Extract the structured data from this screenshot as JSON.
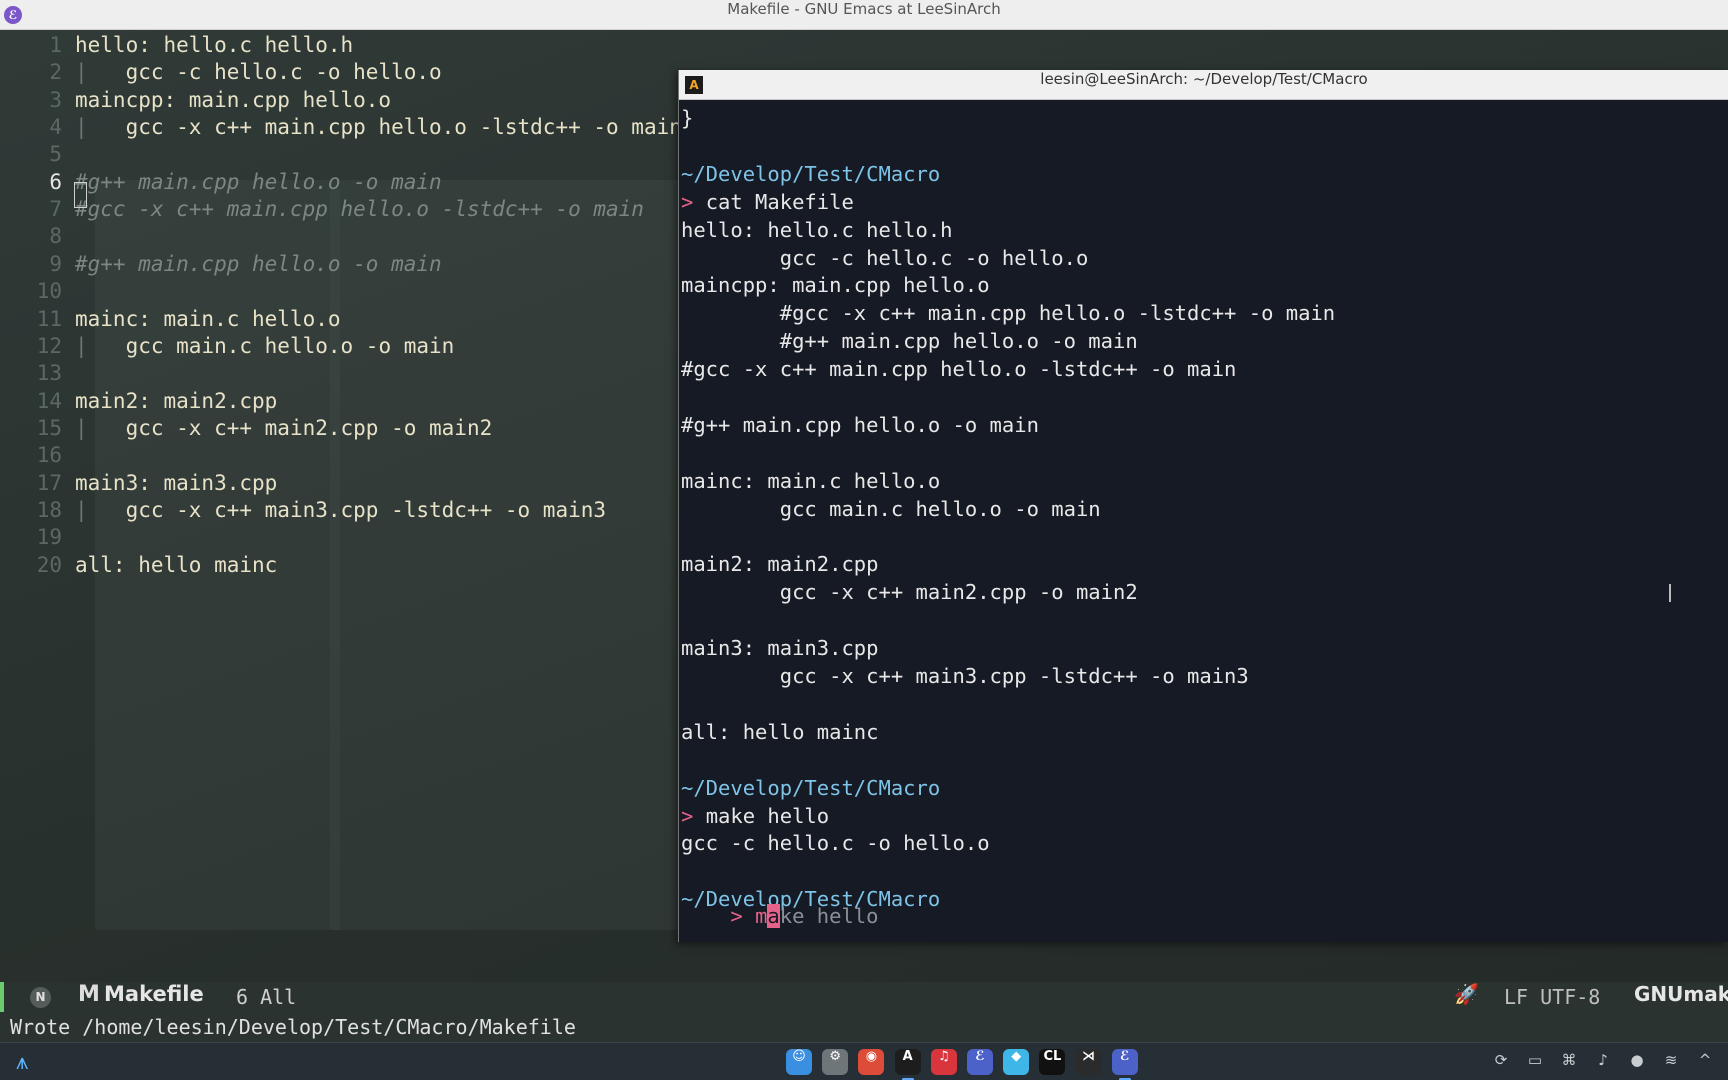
{
  "emacs": {
    "window_title": "Makefile - GNU Emacs at LeeSinArch",
    "app_icon": "emacs-icon",
    "lines": [
      {
        "num": "1",
        "text": "hello: hello.c hello.h",
        "kind": "code"
      },
      {
        "num": "2",
        "bar": "|",
        "text": "   gcc -c hello.c -o hello.o",
        "kind": "code"
      },
      {
        "num": "3",
        "text": "maincpp: main.cpp hello.o",
        "kind": "code"
      },
      {
        "num": "4",
        "bar": "|",
        "text": "   gcc -x c++ main.cpp hello.o -lstdc++ -o main",
        "kind": "code"
      },
      {
        "num": "5",
        "text": "",
        "kind": "code"
      },
      {
        "num": "6",
        "text": "#g++ main.cpp hello.o -o main",
        "kind": "comment"
      },
      {
        "num": "7",
        "text": "#gcc -x c++ main.cpp hello.o -lstdc++ -o main",
        "kind": "comment"
      },
      {
        "num": "8",
        "text": "",
        "kind": "code"
      },
      {
        "num": "9",
        "text": "#g++ main.cpp hello.o -o main",
        "kind": "comment"
      },
      {
        "num": "10",
        "text": "",
        "kind": "code"
      },
      {
        "num": "11",
        "text": "mainc: main.c hello.o",
        "kind": "code"
      },
      {
        "num": "12",
        "bar": "|",
        "text": "   gcc main.c hello.o -o main",
        "kind": "code"
      },
      {
        "num": "13",
        "text": "",
        "kind": "code"
      },
      {
        "num": "14",
        "text": "main2: main2.cpp",
        "kind": "code"
      },
      {
        "num": "15",
        "bar": "|",
        "text": "   gcc -x c++ main2.cpp -o main2",
        "kind": "code"
      },
      {
        "num": "16",
        "text": "",
        "kind": "code"
      },
      {
        "num": "17",
        "text": "main3: main3.cpp",
        "kind": "code"
      },
      {
        "num": "18",
        "bar": "|",
        "text": "   gcc -x c++ main3.cpp -lstdc++ -o main3",
        "kind": "code"
      },
      {
        "num": "19",
        "text": "",
        "kind": "code"
      },
      {
        "num": "20",
        "text": "all: hello mainc",
        "kind": "code"
      }
    ],
    "current_line": "6",
    "modeline": {
      "state_badge": "N",
      "file_icon": "M",
      "file_name": "Makefile",
      "position": "6 All",
      "rocket_icon": "rocket-icon",
      "encoding": "LF UTF-8",
      "major_mode": "GNUmakefile"
    },
    "echo_area": "Wrote /home/leesin/Develop/Test/CMacro/Makefile"
  },
  "terminal": {
    "title": "leesin@LeeSinArch: ~/Develop/Test/CMacro",
    "icon": "terminal-icon",
    "lines": [
      {
        "text": "}",
        "kind": "out"
      },
      {
        "text": "",
        "kind": "out"
      },
      {
        "text": "~/Develop/Test/CMacro",
        "kind": "path"
      },
      {
        "prompt": ">",
        "cmd": "cat",
        "args": " Makefile",
        "kind": "cmd"
      },
      {
        "text": "hello: hello.c hello.h",
        "kind": "out"
      },
      {
        "text": "        gcc -c hello.c -o hello.o",
        "kind": "out"
      },
      {
        "text": "maincpp: main.cpp hello.o",
        "kind": "out"
      },
      {
        "text": "        #gcc -x c++ main.cpp hello.o -lstdc++ -o main",
        "kind": "out"
      },
      {
        "text": "        #g++ main.cpp hello.o -o main",
        "kind": "out"
      },
      {
        "text": "#gcc -x c++ main.cpp hello.o -lstdc++ -o main",
        "kind": "out"
      },
      {
        "text": "",
        "kind": "out"
      },
      {
        "text": "#g++ main.cpp hello.o -o main",
        "kind": "out"
      },
      {
        "text": "",
        "kind": "out"
      },
      {
        "text": "mainc: main.c hello.o",
        "kind": "out"
      },
      {
        "text": "        gcc main.c hello.o -o main",
        "kind": "out"
      },
      {
        "text": "",
        "kind": "out"
      },
      {
        "text": "main2: main2.cpp",
        "kind": "out"
      },
      {
        "text": "        gcc -x c++ main2.cpp -o main2",
        "kind": "out"
      },
      {
        "text": "",
        "kind": "out"
      },
      {
        "text": "main3: main3.cpp",
        "kind": "out"
      },
      {
        "text": "        gcc -x c++ main3.cpp -lstdc++ -o main3",
        "kind": "out"
      },
      {
        "text": "",
        "kind": "out"
      },
      {
        "text": "all: hello mainc",
        "kind": "out"
      },
      {
        "text": "",
        "kind": "out"
      },
      {
        "text": "~/Develop/Test/CMacro",
        "kind": "path"
      },
      {
        "prompt": ">",
        "cmd": "make",
        "args": " hello",
        "kind": "cmd"
      },
      {
        "text": "gcc -c hello.c -o hello.o",
        "kind": "out"
      },
      {
        "text": "",
        "kind": "out"
      },
      {
        "text": "~/Develop/Test/CMacro",
        "kind": "path"
      }
    ],
    "input_line": {
      "prompt": ">",
      "typed": "m",
      "cursor_char": "a",
      "suggestion": "ke hello"
    }
  },
  "taskbar": {
    "launcher_icon": "app-launcher-icon",
    "apps": [
      {
        "name": "finder-icon",
        "glyph": "☺",
        "color": "#3b8fe0"
      },
      {
        "name": "settings-icon",
        "glyph": "⚙",
        "color": "#6f767a"
      },
      {
        "name": "chrome-icon",
        "glyph": "◉",
        "color": "#dd4b39"
      },
      {
        "name": "alacritty-icon",
        "glyph": "A",
        "color": "#1d1d1d",
        "active": true
      },
      {
        "name": "netease-music-icon",
        "glyph": "♫",
        "color": "#d9353d"
      },
      {
        "name": "emacs-icon",
        "glyph": "ℰ",
        "color": "#4d62c9"
      },
      {
        "name": "flutter-icon",
        "glyph": "◆",
        "color": "#3fb6e8"
      },
      {
        "name": "clion-icon",
        "glyph": "CL",
        "color": "#111111"
      },
      {
        "name": "vscode-icon",
        "glyph": "⋊",
        "color": "#2b2b2b"
      },
      {
        "name": "emacs-icon",
        "glyph": "ℰ",
        "color": "#4d62c9",
        "active": true
      }
    ],
    "tray": [
      {
        "name": "update-icon",
        "glyph": "⟳"
      },
      {
        "name": "clipboard-icon",
        "glyph": "▭"
      },
      {
        "name": "keyboard-icon",
        "glyph": "⌘"
      },
      {
        "name": "volume-icon",
        "glyph": "♪"
      },
      {
        "name": "microphone-icon",
        "glyph": "●"
      },
      {
        "name": "wifi-icon",
        "glyph": "≋"
      },
      {
        "name": "chevron-up-icon",
        "glyph": "^"
      }
    ]
  }
}
